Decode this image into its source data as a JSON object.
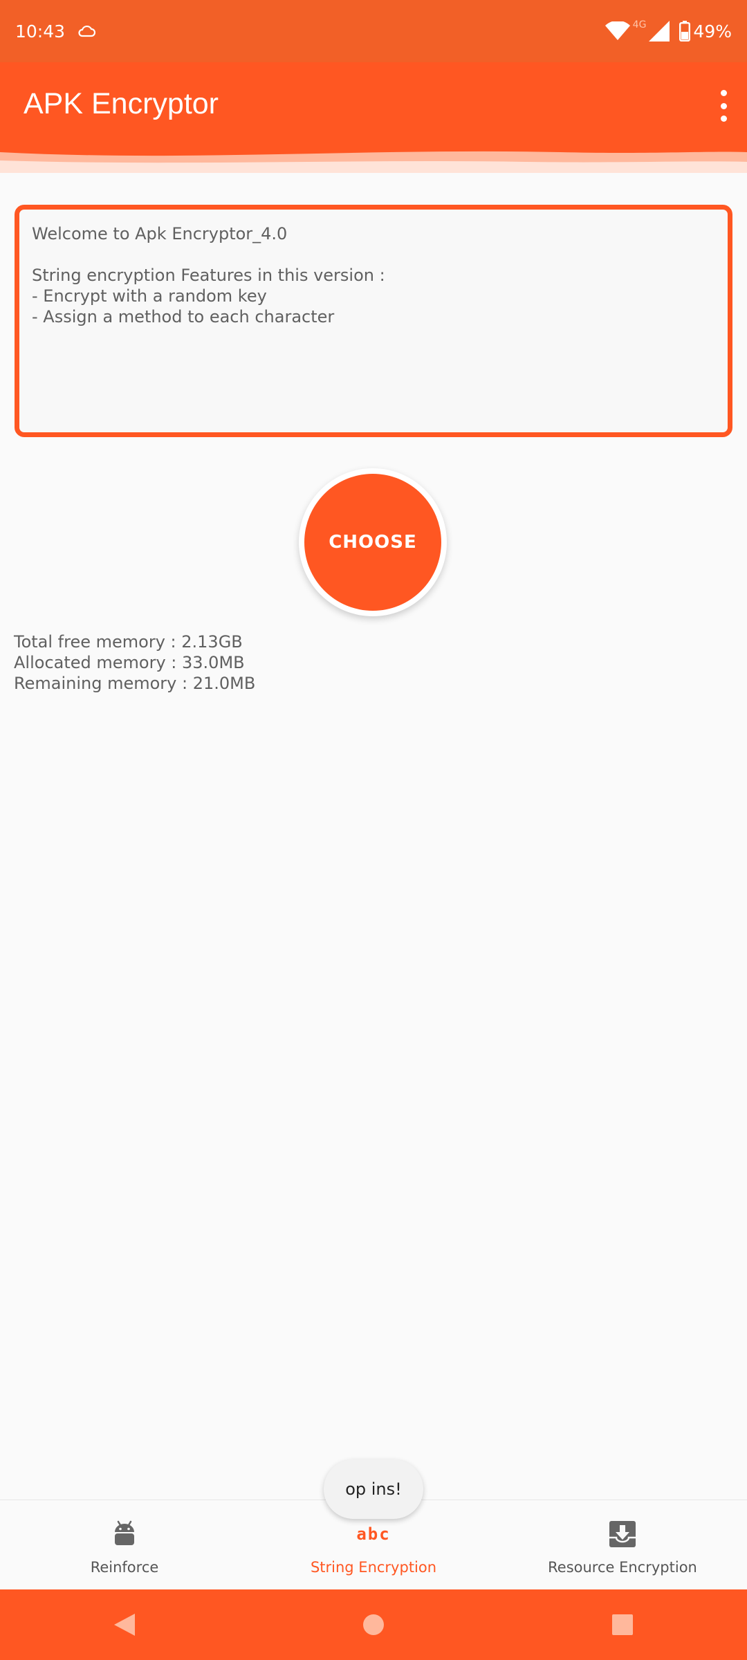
{
  "status_bar": {
    "time": "10:43",
    "network_type": "4G",
    "battery": "49%"
  },
  "app_bar": {
    "title": "APK Encryptor"
  },
  "info_box": {
    "text": "Welcome to Apk Encryptor_4.0\n\nString encryption Features in this version :\n- Encrypt with a random key\n- Assign a method to each character"
  },
  "choose_button": {
    "label": "CHOOSE"
  },
  "memory": {
    "total_free": "Total free memory : 2.13GB",
    "allocated": "Allocated memory : 33.0MB",
    "remaining": "Remaining memory : 21.0MB"
  },
  "toast": {
    "text": "op ins!"
  },
  "bottom_nav": {
    "items": [
      {
        "label": "Reinforce",
        "icon": "android-icon",
        "active": false
      },
      {
        "label": "String Encryption",
        "icon": "abc",
        "active": true
      },
      {
        "label": "Resource Encryption",
        "icon": "inbox-download-icon",
        "active": false
      }
    ]
  },
  "colors": {
    "accent": "#ff5722",
    "status_bar": "#f26027"
  }
}
